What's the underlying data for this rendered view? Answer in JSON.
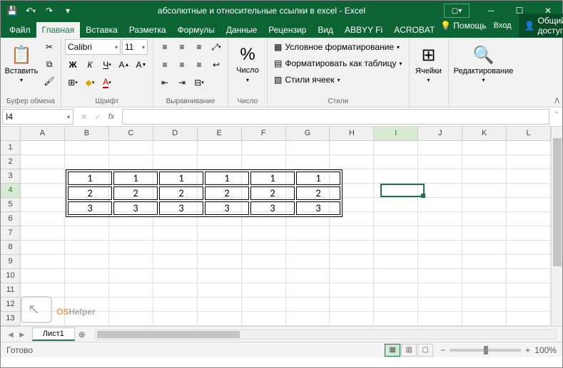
{
  "title": "абсолютные и относительные ссылки в excel - Excel",
  "qat": {
    "save": "💾",
    "undo": "↶",
    "redo": "↷",
    "more": "▾"
  },
  "tabs": [
    "Файл",
    "Главная",
    "Вставка",
    "Разметка",
    "Формулы",
    "Данные",
    "Рецензир",
    "Вид",
    "ABBYY Fi",
    "ACROBAT"
  ],
  "active_tab": 1,
  "help_label": "Помощь",
  "login_label": "Вход",
  "share_label": "Общий доступ",
  "ribbon": {
    "paste": "Вставить",
    "clipboard_label": "Буфер обмена",
    "font_name": "Calibri",
    "font_size": "11",
    "bold": "Ж",
    "italic": "К",
    "underline": "Ч",
    "font_label": "Шрифт",
    "align_label": "Выравнивание",
    "number_btn": "Число",
    "number_label": "Число",
    "cond_format": "Условное форматирование",
    "as_table": "Форматировать как таблицу",
    "cell_styles": "Стили ячеек",
    "styles_label": "Стили",
    "cells_btn": "Ячейки",
    "editing_btn": "Редактирование"
  },
  "namebox": "I4",
  "fx": "fx",
  "columns": [
    "A",
    "B",
    "C",
    "D",
    "E",
    "F",
    "G",
    "H",
    "I",
    "J",
    "K",
    "L"
  ],
  "rows": [
    "1",
    "2",
    "3",
    "4",
    "5",
    "6",
    "7",
    "8",
    "9",
    "10",
    "11",
    "12",
    "13"
  ],
  "active_col": "I",
  "active_row": "4",
  "data_table": [
    [
      "1",
      "1",
      "1",
      "1",
      "1",
      "1"
    ],
    [
      "2",
      "2",
      "2",
      "2",
      "2",
      "2"
    ],
    [
      "3",
      "3",
      "3",
      "3",
      "3",
      "3"
    ]
  ],
  "sheet_name": "Лист1",
  "status": "Готово",
  "zoom": "100%",
  "watermark": {
    "os": "OS",
    "helper": "Helper"
  }
}
